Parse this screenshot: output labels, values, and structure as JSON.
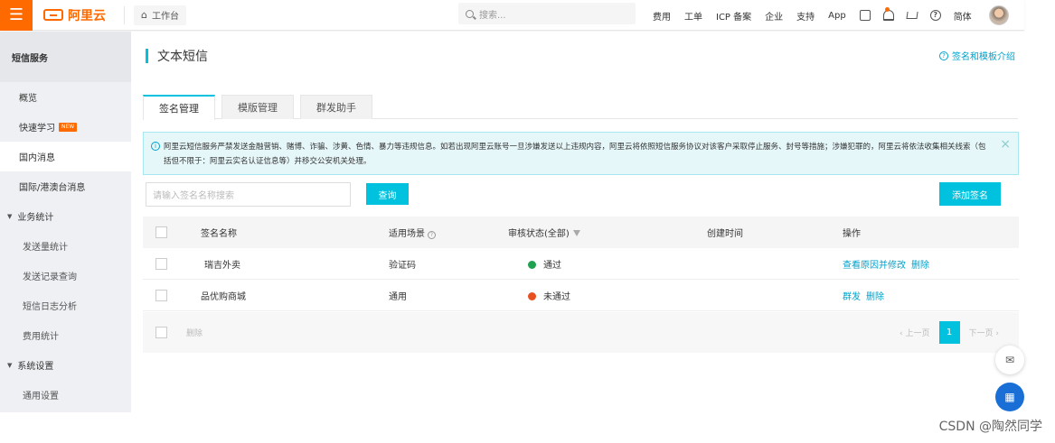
{
  "topbar": {
    "brand": "阿里云",
    "workbench": "工作台",
    "search_placeholder": "搜索...",
    "nav": [
      "费用",
      "工单",
      "ICP 备案",
      "企业",
      "支持",
      "App"
    ],
    "lang": "简体",
    "icons": [
      "menu-icon",
      "home-icon",
      "search-icon",
      "terminal-icon",
      "bell-icon",
      "cart-icon",
      "help-icon"
    ]
  },
  "sidebar": {
    "title": "短信服务",
    "items": [
      {
        "label": "概览"
      },
      {
        "label": "快速学习",
        "badge": "NEW"
      },
      {
        "label": "国内消息"
      },
      {
        "label": "国际/港澳台消息"
      },
      {
        "label": "业务统计"
      },
      {
        "label": "发送量统计"
      },
      {
        "label": "发送记录查询"
      },
      {
        "label": "短信日志分析"
      },
      {
        "label": "费用统计"
      },
      {
        "label": "系统设置"
      },
      {
        "label": "通用设置"
      }
    ]
  },
  "main": {
    "title": "文本短信",
    "help_link": "签名和模板介绍",
    "tabs": [
      {
        "label": "签名管理"
      },
      {
        "label": "模版管理"
      },
      {
        "label": "群发助手"
      }
    ],
    "notice": "阿里云短信服务严禁发送金融营销、赌博、诈骗、涉黄、色情、暴力等违规信息。如若出现阿里云账号一旦涉嫌发送以上违规内容，阿里云将依照短信服务协议对该客户采取停止服务、封号等措施；涉嫌犯罪的，阿里云将依法收集相关线索（包括但不限于：阿里云实名认证信息等）并移交公安机关处理。",
    "search_placeholder": "请输入签名名称搜索",
    "query_button": "查询",
    "add_button": "添加签名",
    "table": {
      "headers": {
        "name": "签名名称",
        "scene": "适用场景",
        "status": "审核状态(全部)",
        "time": "创建时间",
        "op": "操作"
      },
      "rows": [
        {
          "name": "瑞吉外卖",
          "scene": "验证码",
          "status": "通过",
          "status_color": "#1fa14f",
          "time": "",
          "ops": [
            "查看原因并修改",
            "删除"
          ]
        },
        {
          "name": "品优购商城",
          "scene": "通用",
          "status": "未通过",
          "status_color": "#e8501f",
          "time": "",
          "ops": [
            "群发",
            "删除"
          ]
        }
      ]
    },
    "footer": {
      "delete": "删除",
      "prev": "上一页",
      "page": "1",
      "next": "下一页"
    }
  },
  "watermark": "CSDN @陶然同学",
  "colors": {
    "brand": "#ff6a00",
    "accent": "#00c1de",
    "link": "#00a2ca"
  }
}
